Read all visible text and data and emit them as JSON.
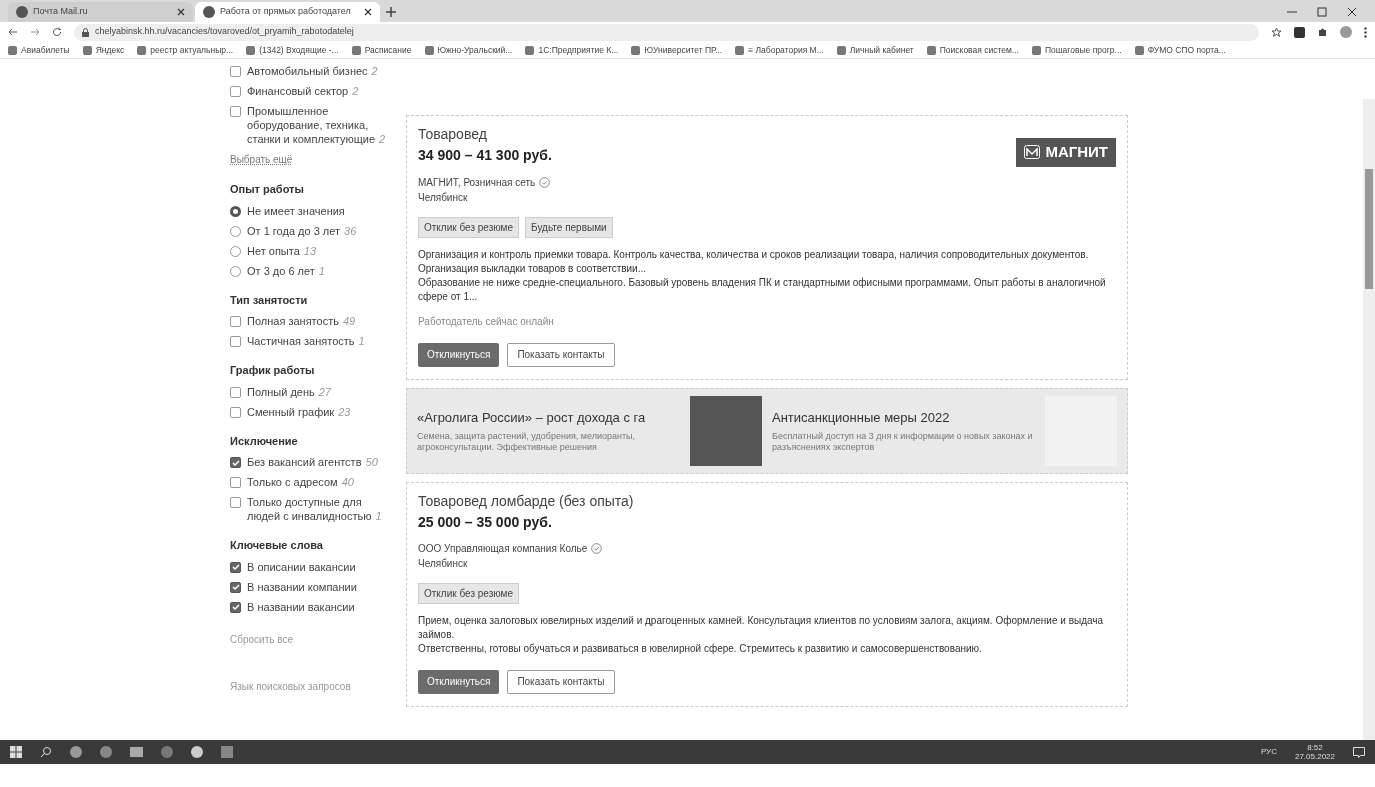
{
  "browser": {
    "tabs": [
      {
        "title": "Почта Mail.ru",
        "selected": false
      },
      {
        "title": "Работа от прямых работодател",
        "selected": true
      }
    ],
    "url": "chelyabinsk.hh.ru/vacancies/tovaroved/ot_pryamih_rabotodatelej",
    "bookmarks": [
      "Авиабилеты",
      "Яндекс",
      "реестр актуальныр...",
      "(1342) Входящие -...",
      "Расписание",
      "Южно-Уральский...",
      "1С:Предприятие К...",
      "ЮУниверситет ПР...",
      "≡ Лаборатория М...",
      "Личный кабинет",
      "Поисковая систем...",
      "Пошаговые прогр...",
      "ФУМО СПО порта..."
    ]
  },
  "sidebar": {
    "groups": [
      {
        "items": [
          {
            "kind": "checkbox",
            "label": "Автомобильный бизнес",
            "count": "2",
            "checked": false
          },
          {
            "kind": "checkbox",
            "label": "Финансовый сектор",
            "count": "2",
            "checked": false
          },
          {
            "kind": "checkbox",
            "label": "Промышленное оборудование, техника, станки и комплектующие",
            "count": "2",
            "checked": false
          }
        ],
        "link": "Выбрать ещё"
      },
      {
        "title": "Опыт работы",
        "items": [
          {
            "kind": "radio",
            "label": "Не имеет значения",
            "selected": true
          },
          {
            "kind": "radio",
            "label": "От 1 года до 3 лет",
            "count": "36",
            "selected": false
          },
          {
            "kind": "radio",
            "label": "Нет опыта",
            "count": "13",
            "selected": false
          },
          {
            "kind": "radio",
            "label": "От 3 до 6 лет",
            "count": "1",
            "selected": false
          }
        ]
      },
      {
        "title": "Тип занятости",
        "items": [
          {
            "kind": "checkbox",
            "label": "Полная занятость",
            "count": "49",
            "checked": false
          },
          {
            "kind": "checkbox",
            "label": "Частичная занятость",
            "count": "1",
            "checked": false
          }
        ]
      },
      {
        "title": "График работы",
        "items": [
          {
            "kind": "checkbox",
            "label": "Полный день",
            "count": "27",
            "checked": false
          },
          {
            "kind": "checkbox",
            "label": "Сменный график",
            "count": "23",
            "checked": false
          }
        ]
      },
      {
        "title": "Исключение",
        "items": [
          {
            "kind": "checkbox",
            "label": "Без вакансий агентств",
            "count": "50",
            "checked": true
          },
          {
            "kind": "checkbox",
            "label": "Только с адресом",
            "count": "40",
            "checked": false
          },
          {
            "kind": "checkbox",
            "label": "Только доступные для людей с инвалидностью",
            "count": "1",
            "checked": false
          }
        ]
      },
      {
        "title": "Ключевые слова",
        "items": [
          {
            "kind": "checkbox",
            "label": "В описании вакансии",
            "checked": true
          },
          {
            "kind": "checkbox",
            "label": "В названии компании",
            "checked": true
          },
          {
            "kind": "checkbox",
            "label": "В названии вакансии",
            "checked": true
          }
        ]
      }
    ],
    "reset": "Сбросить все",
    "language": "Язык поисковых запросов"
  },
  "vacancies": [
    {
      "title": "Товаровед",
      "salary": "34 900 – 41 300 руб.",
      "company": "МАГНИТ, Розничная сеть",
      "city": "Челябинск",
      "logo": "МАГНИТ",
      "tags": [
        "Отклик без резюме",
        "Будьте первыми"
      ],
      "description": [
        "Организация и контроль приемки товара. Контроль качества, количества и сроков реализации товара, наличия сопроводительных документов. Организация выкладки товаров в соответствии...",
        "Образование не ниже средне-специального. Базовый уровень владения ПК и стандартными офисными программами. Опыт работы в аналогичной сфере от 1..."
      ],
      "online": "Работодатель сейчас онлайн",
      "buttons": [
        {
          "label": "Откликнуться",
          "primary": true
        },
        {
          "label": "Показать контакты",
          "primary": false
        }
      ]
    },
    {
      "title": "Товаровед ломбарде (без опыта)",
      "salary": "25 000 – 35 000 руб.",
      "company": "ООО Управляющая компания Колье",
      "city": "Челябинск",
      "tags": [
        "Отклик без резюме"
      ],
      "description": [
        "Прием, оценка залоговых ювелирных изделий и драгоценных камней. Консультация клиентов по условиям залога, акциям. Оформление и выдача займов.",
        "Ответственны, готовы обучаться и развиваться в ювелирной сфере. Стремитесь к развитию и самосовершенствованию."
      ],
      "buttons": [
        {
          "label": "Откликнуться",
          "primary": true
        },
        {
          "label": "Показать контакты",
          "primary": false
        }
      ]
    }
  ],
  "ads": [
    {
      "title": "«Агролига России» – рост дохода с га",
      "text": "Семена, защита растений, удобрения, мелиоранты, агроконсультации. Эффективные решения"
    },
    {
      "title": "Антисанкционные меры 2022",
      "text": "Бесплатный доступ на 3 дня к информации о новых законах и разъяснениях экспертов"
    }
  ],
  "taskbar": {
    "language": "РУС",
    "time": "8:52",
    "date": "27.05.2022"
  }
}
